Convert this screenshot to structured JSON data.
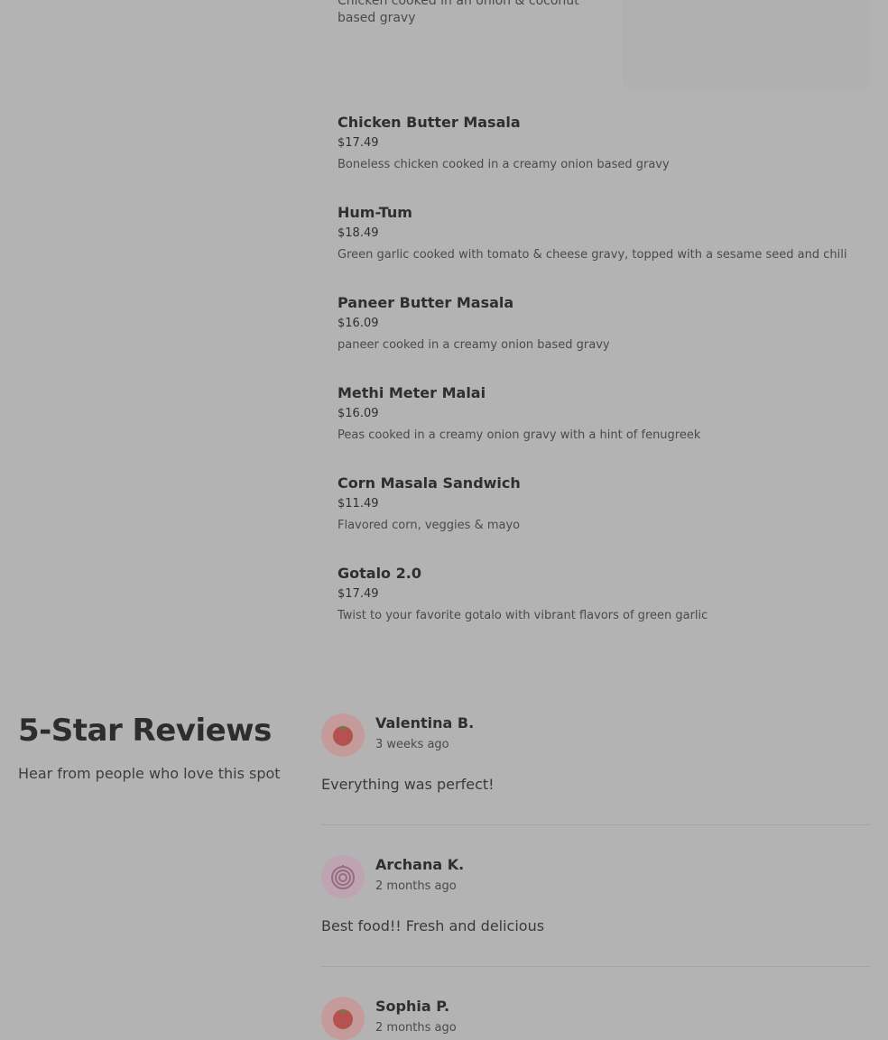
{
  "menu": {
    "partial_item": {
      "description": "Chicken cooked in an onion & coconut based gravy"
    },
    "items": [
      {
        "name": "Chicken Butter Masala",
        "price": "$17.49",
        "description": "Boneless chicken cooked in a creamy onion based gravy"
      },
      {
        "name": "Hum-Tum",
        "price": "$18.49",
        "description": "Green garlic cooked with tomato & cheese gravy, topped with a sesame seed and chili"
      },
      {
        "name": "Paneer Butter Masala",
        "price": "$16.09",
        "description": "paneer cooked in a creamy onion based gravy"
      },
      {
        "name": "Methi Meter Malai",
        "price": "$16.09",
        "description": "Peas cooked in a creamy onion gravy with a hint of fenugreek"
      },
      {
        "name": "Corn Masala Sandwich",
        "price": "$11.49",
        "description": "Flavored corn, veggies & mayo"
      },
      {
        "name": "Gotalo 2.0",
        "price": "$17.49",
        "description": "Twist to your favorite gotalo with vibrant flavors of green garlic"
      }
    ]
  },
  "reviews": {
    "title": "5-Star Reviews",
    "subtitle": "Hear from people who love this spot",
    "list": [
      {
        "name": "Valentina B.",
        "when": "3 weeks ago",
        "text": "Everything was perfect!",
        "avatar_icon": "tomato-icon"
      },
      {
        "name": "Archana K.",
        "when": "2 months ago",
        "text": "Best food!! Fresh and delicious",
        "avatar_icon": "onion-icon"
      },
      {
        "name": "Sophia P.",
        "when": "2 months ago",
        "text": "",
        "avatar_icon": "tomato-icon"
      }
    ]
  },
  "colors": {
    "overlay_background": "#b3b3b3",
    "tomato": "#b5524f",
    "onion": "#9a6a84"
  }
}
